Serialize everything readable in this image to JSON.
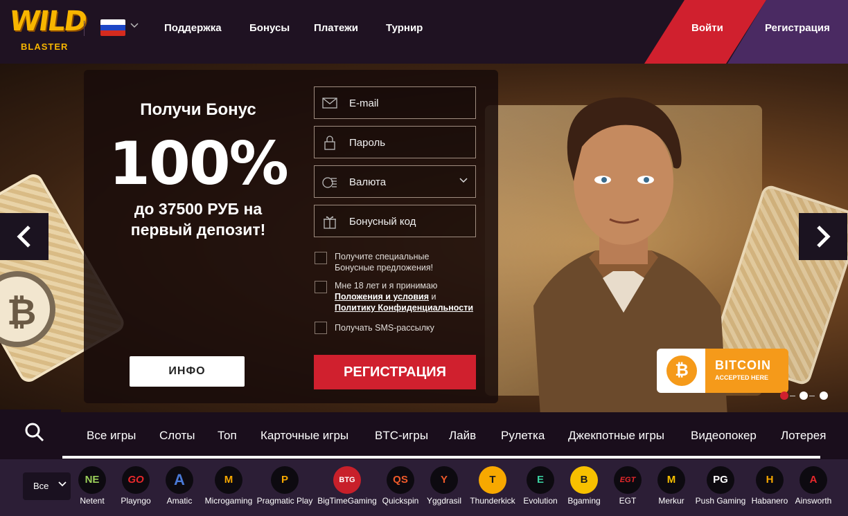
{
  "header": {
    "logo_top": "WILD",
    "logo_bottom": "BLASTER",
    "nav": [
      "Поддержка",
      "Бонусы",
      "Платежи",
      "Турнир"
    ],
    "login": "Войти",
    "register": "Регистрация"
  },
  "promo": {
    "line1": "Получи Бонус",
    "big": "100%",
    "line3a": "до 37500 РУБ на",
    "line3b": "первый депозит!",
    "info": "ИНФО"
  },
  "form": {
    "email": "E-mail",
    "password": "Пароль",
    "currency": "Валюта",
    "bonus_code": "Бонусный код",
    "check1a": "Получите специальные",
    "check1b": "Бонусные предложения!",
    "check2a": "Мне 18 лет и я принимаю",
    "check2_link1": "Положения и условия",
    "check2_and": " и",
    "check2_link2": "Политику Конфиденциальности",
    "check3": "Получать SMS-рассылку",
    "submit": "РЕГИСТРАЦИЯ"
  },
  "badge": {
    "title": "BITCOIN",
    "subtitle": "ACCEPTED HERE",
    "symbol": "₿"
  },
  "slider": {
    "active_index": 0,
    "count": 3
  },
  "categories": [
    "Все игры",
    "Слоты",
    "Топ",
    "Карточные игры",
    "BTC-игры",
    "Лайв",
    "Рулетка",
    "Джекпотные игры",
    "Видеопокер",
    "Лотерея"
  ],
  "providers_filter": "Все",
  "providers": [
    {
      "name": "Netent",
      "mark": "NE"
    },
    {
      "name": "Playngo",
      "mark": "GO"
    },
    {
      "name": "Amatic",
      "mark": "A"
    },
    {
      "name": "Microgaming",
      "mark": "M"
    },
    {
      "name": "Pragmatic Play",
      "mark": "P"
    },
    {
      "name": "BigTimeGaming",
      "mark": "BTG"
    },
    {
      "name": "Quickspin",
      "mark": "QS"
    },
    {
      "name": "Yggdrasil",
      "mark": "Y"
    },
    {
      "name": "Thunderkick",
      "mark": "T"
    },
    {
      "name": "Evolution",
      "mark": "E"
    },
    {
      "name": "Bgaming",
      "mark": "B"
    },
    {
      "name": "EGT",
      "mark": "EGT"
    },
    {
      "name": "Merkur",
      "mark": "M"
    },
    {
      "name": "Push Gaming",
      "mark": "PG"
    },
    {
      "name": "Habanero",
      "mark": "H"
    },
    {
      "name": "Ainsworth",
      "mark": "A"
    }
  ],
  "colors": {
    "brand_red": "#d0202e",
    "brand_purple": "#4a2a62",
    "logo_yellow": "#f7b500",
    "bitcoin_orange": "#f59a1a"
  }
}
